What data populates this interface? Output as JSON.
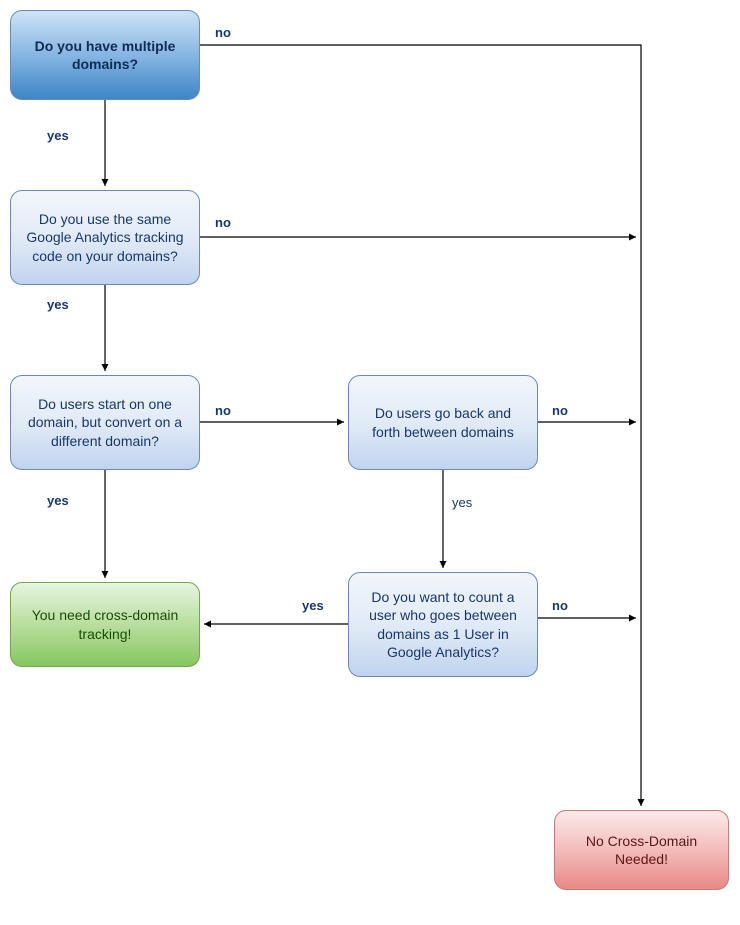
{
  "nodes": {
    "n1": {
      "text": "Do you have multiple domains?",
      "style": "blue-dark"
    },
    "n2": {
      "text": "Do you use the same Google Analytics tracking code on your domains?",
      "style": "blue-light"
    },
    "n3": {
      "text": "Do users start on one domain, but convert on a different domain?",
      "style": "blue-light"
    },
    "n4": {
      "text": "Do users go back and forth between domains",
      "style": "blue-light"
    },
    "n5": {
      "text": "Do you want to count a user who goes between domains as 1 User in Google Analytics?",
      "style": "blue-light"
    },
    "n6": {
      "text": "You need cross-domain tracking!",
      "style": "green"
    },
    "n7": {
      "text": "No Cross-Domain Needed!",
      "style": "red"
    }
  },
  "labels": {
    "yes": "yes",
    "no": "no"
  }
}
